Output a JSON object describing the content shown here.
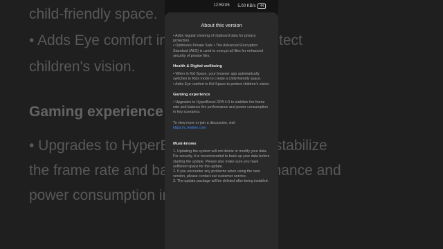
{
  "background": {
    "lines": [
      "child-friendly space.",
      "• Adds Eye comfort in Kid Space to protect",
      "children's vision.",
      "Gaming experience",
      "• Upgrades to HyperBoost GPA 4.0 to stabilize",
      "the frame rate and balance the performance and",
      "power consumption in key scenarios."
    ]
  },
  "status_bar": {
    "time": "12:59:05",
    "indicators": "5.00 KB/s",
    "battery": "44"
  },
  "sheet": {
    "title": "About this version",
    "intro": [
      "• Adds regular clearing of clipboard data for privacy protection.",
      "• Optimizes Private Safe • The Advanced Encryption Standard (AES) is used to encrypt all files for enhanced security of private files."
    ],
    "health": {
      "title": "Health & Digital wellbeing",
      "items": [
        "• When in Kid Space, your browser app automatically switches to Kids mode to create a child-friendly space.",
        "• Adds Eye comfort in Kid Space to protect children's vision."
      ]
    },
    "gaming": {
      "title": "Gaming experience",
      "items": [
        "• Upgrades to HyperBoost GPA 4.0 to stabilize the frame rate and balance the performance and power consumption in key scenarios."
      ]
    },
    "discussion": {
      "text": "To view more or join a discussion, visit",
      "link": "https://c.realme.com"
    },
    "must_knows": {
      "title": "Must-knows",
      "items": [
        "1. Updating the system will not delete or modify your data. For security, it is recommended to back up your data before starting the update. Please also make sure you have sufficient space for the update.",
        "2. If you encounter any problems when using the new version, please contact our customer service.",
        "3. The update package will be deleted after being installed."
      ]
    }
  }
}
